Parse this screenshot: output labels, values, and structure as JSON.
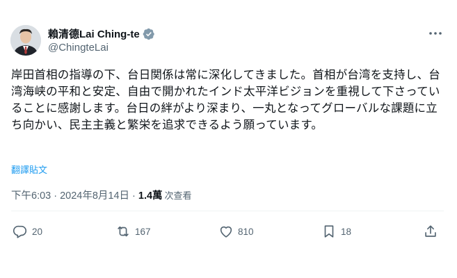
{
  "author": {
    "display_name": "賴清德Lai Ching-te",
    "handle": "@ChingteLai",
    "verified_icon": "verified-badge-icon"
  },
  "tweet": {
    "text": "岸田首相の指導の下、台日関係は常に深化してきました。首相が台湾を支持し、台湾海峡の平和と安定、自由で開かれたインド太平洋ビジョンを重視して下さっていることに感謝します。台日の絆がより深まり、一丸となってグローバルな課題に立ち向かい、民主主義と繁栄を追求できるよう願っています。",
    "translate_label": "翻譯貼文",
    "time": "下午6:03",
    "separator": "·",
    "date": "2024年8月14日",
    "views_count": "1.4萬",
    "views_label": "次查看"
  },
  "actions": {
    "replies": "20",
    "retweets": "167",
    "likes": "810",
    "bookmarks": "18"
  },
  "colors": {
    "accent": "#1d9bf0",
    "text": "#0f1419",
    "secondary": "#536471"
  }
}
